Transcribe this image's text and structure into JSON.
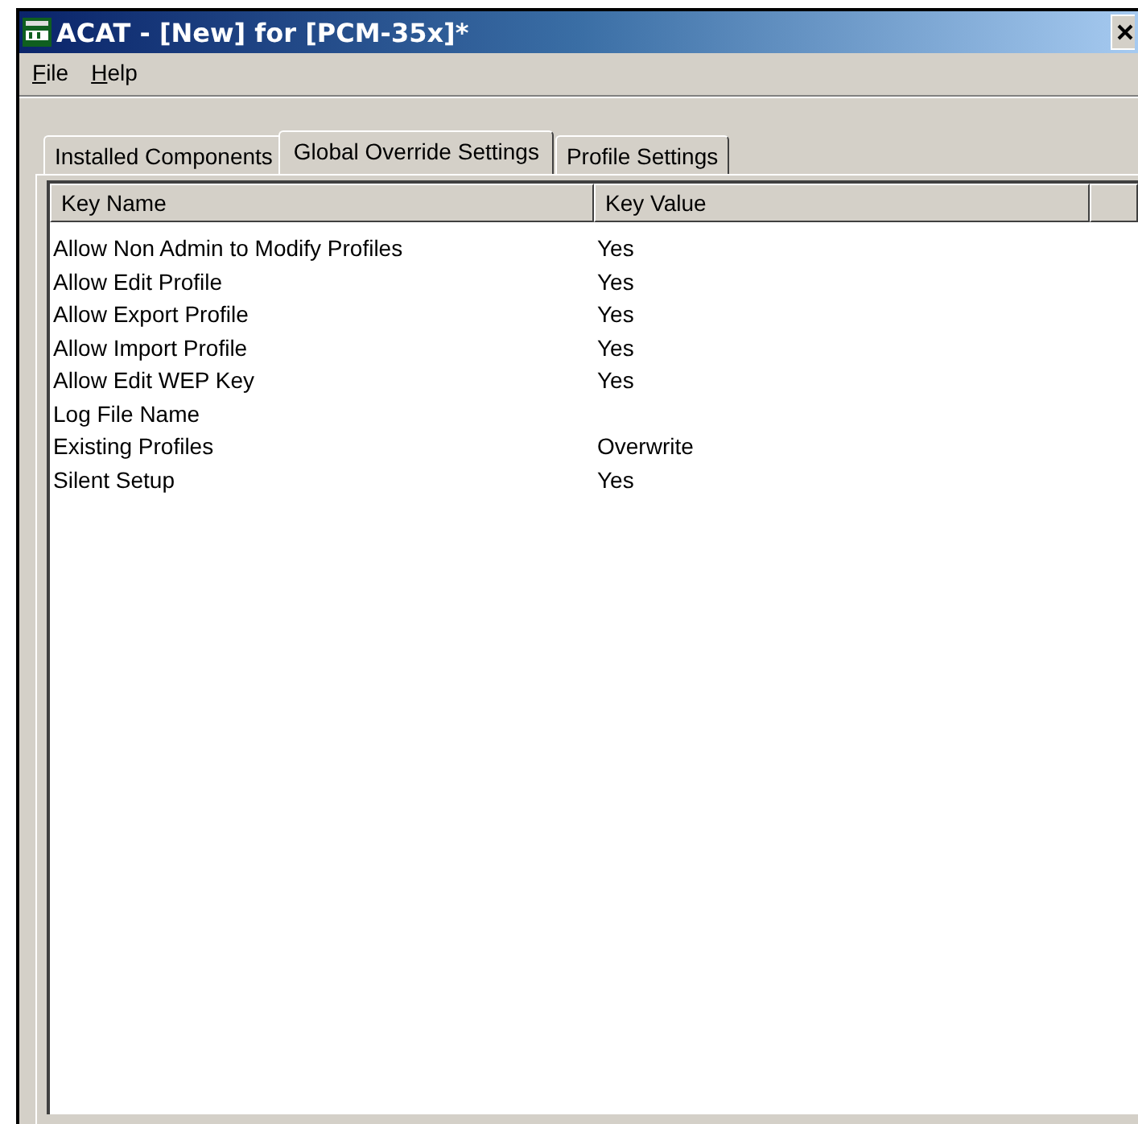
{
  "window": {
    "title": "ACAT - [New] for [PCM-35x]*"
  },
  "menu": [
    "File",
    "Help"
  ],
  "tabs": [
    {
      "label": "Installed Components",
      "selected": false
    },
    {
      "label": "Global Override Settings",
      "selected": true
    },
    {
      "label": "Profile Settings",
      "selected": false
    }
  ],
  "table": {
    "columns": [
      "Key Name",
      "Key Value"
    ],
    "rows": [
      {
        "key": "Allow Non Admin to Modify Profiles",
        "value": "Yes"
      },
      {
        "key": "Allow Edit Profile",
        "value": "Yes"
      },
      {
        "key": "Allow Export Profile",
        "value": "Yes"
      },
      {
        "key": "Allow Import Profile",
        "value": "Yes"
      },
      {
        "key": "Allow Edit WEP Key",
        "value": "Yes"
      },
      {
        "key": "Log File Name",
        "value": ""
      },
      {
        "key": "Existing Profiles",
        "value": "Overwrite"
      },
      {
        "key": "Silent Setup",
        "value": "Yes"
      }
    ]
  }
}
